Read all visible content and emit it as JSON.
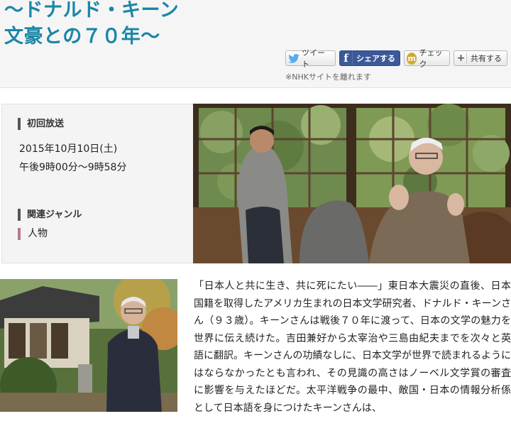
{
  "title": {
    "line1": "〜ドナルド・キーン",
    "line2": "文豪との７０年〜"
  },
  "share": {
    "tweet": "ツイート",
    "facebook": "シェアする",
    "mixi": "チェック",
    "more": "共有する",
    "note": "※NHKサイトを離れます",
    "icons": [
      "twitter-bird-icon",
      "facebook-f-icon",
      "mixi-m-icon",
      "plus-icon"
    ]
  },
  "broadcast": {
    "heading": "初回放送",
    "date": "2015年10月10日(土)",
    "time": "午後9時00分〜9時58分"
  },
  "genre": {
    "heading": "関連ジャンル",
    "item": "人物"
  },
  "description": "「日本人と共に生き、共に死にたい――」東日本大震災の直後、日本国籍を取得したアメリカ生まれの日本文学研究者、ドナルド・キーンさん（９３歳）。キーンさんは戦後７０年に渡って、日本の文学の魅力を世界に伝え続けた。吉田兼好から太宰治や三島由紀夫までを次々と英語に翻訳。キーンさんの功績なしに、日本文学が世界で読まれるようにはならなかったとも言われ、その見識の高さはノーベル文学賞の審査に影響を与えたほどだ。太平洋戦争の最中、敵国・日本の情報分析係として日本語を身につけたキーンさんは、",
  "colors": {
    "title": "#1a86a6",
    "facebook": "#3b5998",
    "mixi": "#d1a837",
    "genre_bar": "#b57794"
  }
}
